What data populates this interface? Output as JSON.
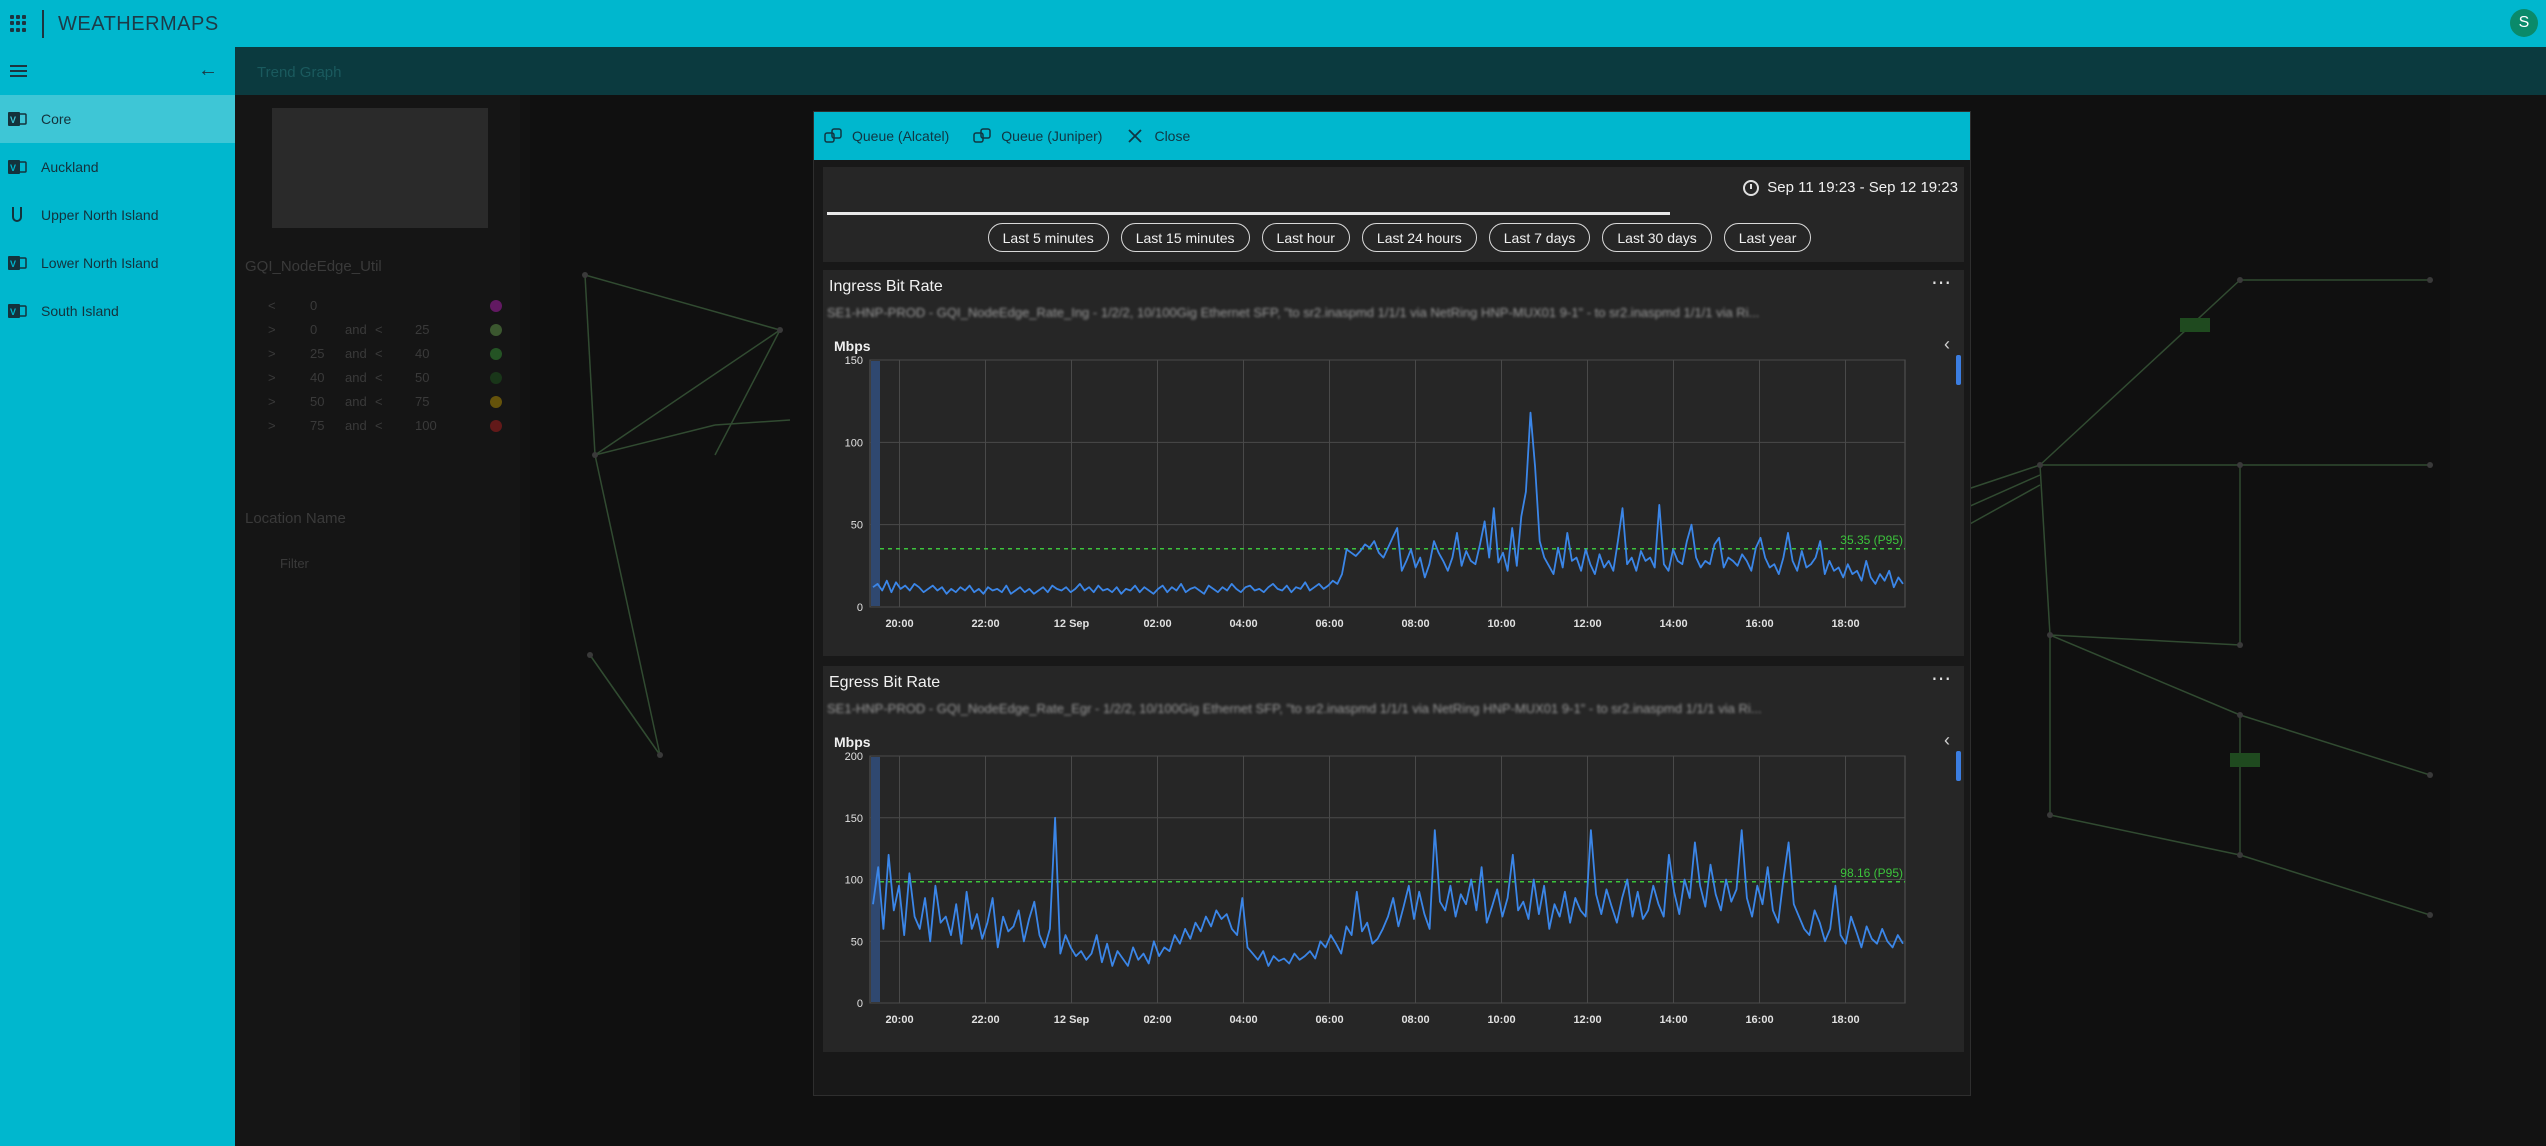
{
  "app": {
    "title": "WEATHERMAPS",
    "avatar_initial": "S",
    "accent": "#00b7ce"
  },
  "sidebar": {
    "items": [
      {
        "label": "Core",
        "active": true
      },
      {
        "label": "Auckland",
        "active": false
      },
      {
        "label": "Upper North Island",
        "active": false
      },
      {
        "label": "Lower North Island",
        "active": false
      },
      {
        "label": "South Island",
        "active": false
      }
    ]
  },
  "background": {
    "header_label": "Trend Graph",
    "filter_title": "GQI_NodeEdge_Util",
    "legend_rows": [
      [
        "<",
        "0",
        "",
        "",
        ""
      ],
      [
        ">",
        "0",
        "and",
        "<",
        "25"
      ],
      [
        ">",
        "25",
        "and",
        "<",
        "40"
      ],
      [
        ">",
        "40",
        "and",
        "<",
        "50"
      ],
      [
        ">",
        "50",
        "and",
        "<",
        "75"
      ],
      [
        ">",
        "75",
        "and",
        "<",
        "100"
      ]
    ],
    "legend_colors": [
      "#c020c0",
      "#6aa84f",
      "#38a038",
      "#206020",
      "#c8a000",
      "#c02020"
    ],
    "location_title": "Location Name",
    "filter_placeholder": "Filter"
  },
  "modal": {
    "toolbar": {
      "queue_alcatel": "Queue (Alcatel)",
      "queue_juniper": "Queue (Juniper)",
      "close": "Close"
    },
    "time_range": "Sep 11 19:23 - Sep 12 19:23",
    "range_buttons": [
      "Last 5 minutes",
      "Last 15 minutes",
      "Last hour",
      "Last 24 hours",
      "Last 7 days",
      "Last 30 days",
      "Last year"
    ]
  },
  "chart_data": [
    {
      "type": "line",
      "title": "Ingress Bit Rate",
      "subtitle": "SE1-HNP-PROD - GQI_NodeEdge_Rate_Ing - 1/2/2, 10/100Gig Ethernet SFP, \"to sr2.inaspmd 1/1/1 via NetRing HNP-MUX01 9-1\" - to sr2.inaspmd 1/1/1 via Ri...",
      "ylabel": "Mbps",
      "ylim": [
        0,
        150
      ],
      "yticks": [
        0,
        50,
        100,
        150
      ],
      "xticks": [
        "20:00",
        "22:00",
        "12 Sep",
        "02:00",
        "04:00",
        "06:00",
        "08:00",
        "10:00",
        "12:00",
        "14:00",
        "16:00",
        "18:00"
      ],
      "x_range": [
        "Sep 11 19:23",
        "Sep 12 19:23"
      ],
      "reference_label": "35.35 (P95)",
      "reference_value": 35.35,
      "line_color": "#3b86e8",
      "reference_color": "#3cc43c",
      "series": [
        {
          "values": [
            12,
            14,
            10,
            16,
            9,
            15,
            11,
            13,
            10,
            14,
            12,
            9,
            11,
            13,
            10,
            12,
            8,
            11,
            9,
            12,
            10,
            13,
            9,
            11,
            8,
            12,
            10,
            11,
            9,
            13,
            8,
            10,
            12,
            9,
            11,
            8,
            10,
            12,
            9,
            13,
            11,
            10,
            12,
            9,
            11,
            14,
            10,
            12,
            9,
            13,
            10,
            11,
            9,
            12,
            8,
            11,
            10,
            13,
            9,
            12,
            10,
            8,
            11,
            13,
            9,
            12,
            10,
            14,
            9,
            11,
            12,
            10,
            8,
            13,
            11,
            9,
            12,
            10,
            14,
            11,
            9,
            12,
            13,
            10,
            11,
            9,
            12,
            14,
            11,
            10,
            13,
            9,
            12,
            11,
            15,
            10,
            12,
            14,
            11,
            13,
            16,
            14,
            20,
            35,
            33,
            31,
            34,
            38,
            36,
            40,
            33,
            30,
            36,
            42,
            48,
            22,
            28,
            35,
            24,
            30,
            18,
            26,
            40,
            33,
            28,
            22,
            30,
            45,
            25,
            34,
            28,
            26,
            38,
            52,
            30,
            60,
            27,
            33,
            22,
            48,
            25,
            55,
            70,
            118,
            85,
            40,
            30,
            25,
            20,
            36,
            24,
            45,
            28,
            30,
            22,
            35,
            26,
            20,
            32,
            24,
            28,
            22,
            40,
            60,
            26,
            30,
            22,
            34,
            28,
            30,
            24,
            62,
            26,
            22,
            35,
            28,
            26,
            40,
            50,
            30,
            24,
            28,
            26,
            38,
            42,
            24,
            30,
            28,
            25,
            32,
            28,
            22,
            36,
            42,
            30,
            24,
            26,
            20,
            30,
            45,
            28,
            22,
            34,
            24,
            26,
            30,
            40,
            20,
            28,
            22,
            24,
            18,
            26,
            20,
            22,
            16,
            28,
            18,
            14,
            20,
            16,
            22,
            12,
            18,
            14
          ]
        }
      ]
    },
    {
      "type": "line",
      "title": "Egress Bit Rate",
      "subtitle": "SE1-HNP-PROD - GQI_NodeEdge_Rate_Egr - 1/2/2, 10/100Gig Ethernet SFP, \"to sr2.inaspmd 1/1/1 via NetRing HNP-MUX01 9-1\" - to sr2.inaspmd 1/1/1 via Ri...",
      "ylabel": "Mbps",
      "ylim": [
        0,
        200
      ],
      "yticks": [
        0,
        50,
        100,
        150,
        200
      ],
      "xticks": [
        "20:00",
        "22:00",
        "12 Sep",
        "02:00",
        "04:00",
        "06:00",
        "08:00",
        "10:00",
        "12:00",
        "14:00",
        "16:00",
        "18:00"
      ],
      "x_range": [
        "Sep 11 19:23",
        "Sep 12 19:23"
      ],
      "reference_label": "98.16 (P95)",
      "reference_value": 98.16,
      "line_color": "#3b86e8",
      "reference_color": "#3cc43c",
      "series": [
        {
          "values": [
            80,
            110,
            60,
            120,
            75,
            95,
            55,
            105,
            70,
            60,
            85,
            50,
            95,
            65,
            70,
            55,
            80,
            48,
            90,
            60,
            72,
            52,
            65,
            85,
            45,
            70,
            58,
            62,
            75,
            50,
            68,
            82,
            55,
            45,
            60,
            150,
            40,
            55,
            45,
            38,
            42,
            35,
            40,
            55,
            33,
            48,
            30,
            42,
            36,
            30,
            45,
            35,
            40,
            32,
            50,
            38,
            45,
            42,
            55,
            48,
            60,
            52,
            65,
            58,
            70,
            62,
            75,
            68,
            72,
            60,
            55,
            85,
            45,
            40,
            35,
            42,
            30,
            38,
            34,
            36,
            32,
            40,
            35,
            38,
            42,
            36,
            50,
            45,
            55,
            48,
            40,
            62,
            55,
            90,
            58,
            65,
            48,
            52,
            60,
            70,
            85,
            62,
            78,
            95,
            68,
            90,
            72,
            60,
            140,
            82,
            75,
            95,
            70,
            88,
            80,
            100,
            75,
            110,
            65,
            78,
            92,
            70,
            85,
            120,
            75,
            82,
            68,
            100,
            72,
            95,
            60,
            80,
            70,
            90,
            65,
            85,
            75,
            70,
            140,
            88,
            72,
            92,
            78,
            65,
            85,
            100,
            70,
            90,
            68,
            75,
            95,
            80,
            70,
            120,
            90,
            72,
            100,
            85,
            130,
            95,
            78,
            112,
            88,
            75,
            100,
            82,
            92,
            140,
            85,
            70,
            95,
            80,
            110,
            75,
            65,
            100,
            130,
            80,
            70,
            60,
            55,
            75,
            65,
            50,
            60,
            95,
            55,
            48,
            70,
            58,
            45,
            62,
            52,
            48,
            60,
            50,
            45,
            55,
            48
          ]
        }
      ]
    }
  ]
}
